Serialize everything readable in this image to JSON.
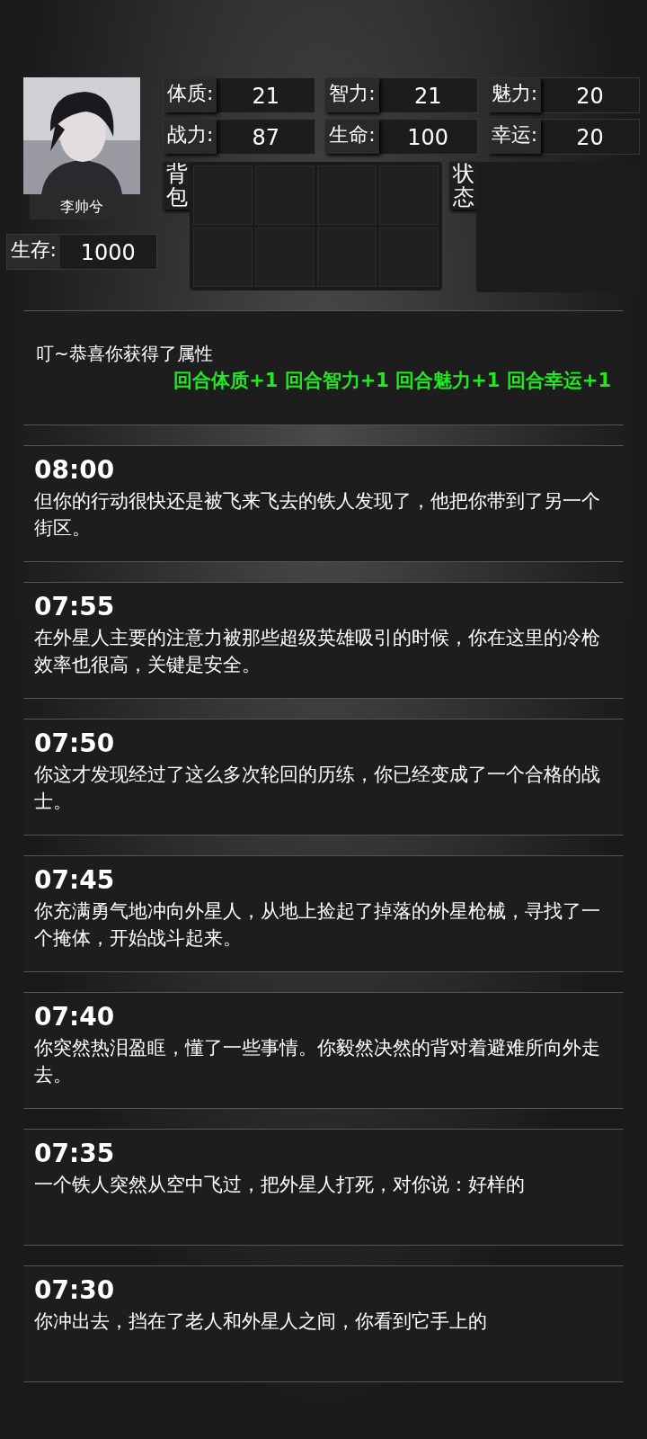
{
  "profile": {
    "name": "李帅兮"
  },
  "stats": [
    {
      "label": "体质:",
      "value": "21"
    },
    {
      "label": "智力:",
      "value": "21"
    },
    {
      "label": "魅力:",
      "value": "20"
    },
    {
      "label": "战力:",
      "value": "87"
    },
    {
      "label": "生命:",
      "value": "100"
    },
    {
      "label": "幸运:",
      "value": "20"
    }
  ],
  "survival": {
    "label": "生存:",
    "value": "1000"
  },
  "backpack": {
    "label": "背包"
  },
  "status": {
    "label": "状态"
  },
  "notice": {
    "text": "叮~恭喜你获得了属性",
    "bonus": "回合体质+1 回合智力+1 回合魅力+1 回合幸运+1"
  },
  "log": [
    {
      "time": "08:00",
      "text": "但你的行动很快还是被飞来飞去的铁人发现了，他把你带到了另一个街区。"
    },
    {
      "time": "07:55",
      "text": "在外星人主要的注意力被那些超级英雄吸引的时候，你在这里的冷枪效率也很高，关键是安全。"
    },
    {
      "time": "07:50",
      "text": "你这才发现经过了这么多次轮回的历练，你已经变成了一个合格的战士。"
    },
    {
      "time": "07:45",
      "text": "你充满勇气地冲向外星人，从地上捡起了掉落的外星枪械，寻找了一个掩体，开始战斗起来。"
    },
    {
      "time": "07:40",
      "text": "你突然热泪盈眶，懂了一些事情。你毅然决然的背对着避难所向外走去。"
    },
    {
      "time": "07:35",
      "text": "一个铁人突然从空中飞过，把外星人打死，对你说：好样的"
    },
    {
      "time": "07:30",
      "text": "你冲出去，挡在了老人和外星人之间，你看到它手上的"
    }
  ]
}
